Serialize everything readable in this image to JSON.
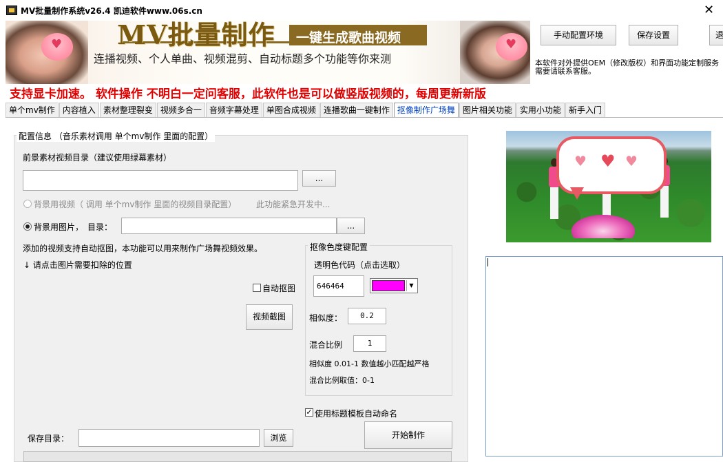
{
  "window": {
    "title": "MV批量制作系统v26.4    凯迪软件www.06s.cn"
  },
  "banner": {
    "title": "MV批量制作",
    "slogan": "一键生成歌曲视频",
    "subtitle": "连播视频、个人单曲、视频混剪、自动标题多个功能等你来测"
  },
  "header_buttons": {
    "env": "手动配置环境",
    "save_settings": "保存设置",
    "partial": "退"
  },
  "oem_note": {
    "line1": "本软件对外提供OEM（修改版权）和界面功能定制服务",
    "line2": "需要请联系客服。"
  },
  "notice": "支持显卡加速。 软件操作 不明白一定问客服，此软件也是可以做竖版视频的，每周更新新版",
  "tabs": [
    {
      "label": "单个mv制作"
    },
    {
      "label": "内容植入"
    },
    {
      "label": "素材整理裂变"
    },
    {
      "label": "视频多合一"
    },
    {
      "label": "音频字幕处理"
    },
    {
      "label": "单图合成视频"
    },
    {
      "label": "连播歌曲一键制作"
    },
    {
      "label": "抠像制作广场舞"
    },
    {
      "label": "图片相关功能"
    },
    {
      "label": "实用小功能"
    },
    {
      "label": "新手入门"
    }
  ],
  "active_tab": 7,
  "config": {
    "caption": "配置信息 （音乐素材调用  单个mv制作  里面的配置）",
    "fg_dir_label": "前景素材视频目录（建议使用绿幕素材）",
    "fg_dir_value": "",
    "browse": "...",
    "bg_video_label": "背景用视频（ 调用  单个mv制作  里面的视频目录配置）",
    "bg_video_dev_note": "此功能紧急开发中...",
    "bg_image_label": "背景用图片，",
    "dir_label": "目录：",
    "bg_image_value": "",
    "info_line1": "添加的视频支持自动抠图，本功能可以用来制作广场舞视频效果。",
    "info_line2": "↓  请点击图片需要扣除的位置",
    "auto_matte_label": "自动抠图",
    "auto_matte_checked": false,
    "video_capture_button": "视频截图",
    "bg_mode_video_selected": false,
    "bg_mode_image_selected": true
  },
  "chroma": {
    "caption": "抠像色度键配置",
    "transparent_label": "透明色代码（点击选取）",
    "color_code": "646464",
    "swatch_color": "#ff00ff",
    "similarity_label": "相似度：",
    "similarity_value": "0.2",
    "blend_label": "混合比例",
    "blend_value": "1",
    "hint1": "相似度 0.01-1 数值越小匹配越严格",
    "hint2": "混合比例取值：0-1"
  },
  "title_template_label": "使用标题模板自动命名",
  "title_template_checked": true,
  "save_dir_label": "保存目录：",
  "save_dir_value": "",
  "browse_button": "浏览",
  "start_button": "开始制作",
  "log_text": ""
}
